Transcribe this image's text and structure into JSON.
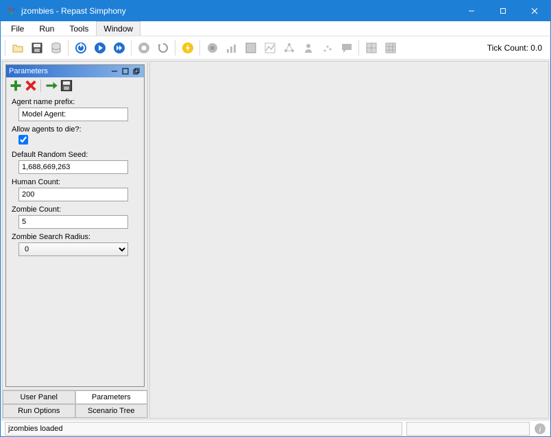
{
  "titlebar": {
    "title": "jzombies - Repast Simphony"
  },
  "menu": {
    "items": [
      "File",
      "Run",
      "Tools",
      "Window"
    ],
    "active_index": 3
  },
  "toolbar": {
    "tick_label": "Tick Count: 0.0"
  },
  "panel": {
    "title": "Parameters",
    "params": {
      "agent_prefix": {
        "label": "Agent name prefix:",
        "value": "Model Agent:"
      },
      "allow_die": {
        "label": "Allow agents to die?:",
        "value": true
      },
      "random_seed": {
        "label": "Default Random Seed:",
        "value": "1,688,669,263"
      },
      "human_count": {
        "label": "Human Count:",
        "value": "200"
      },
      "zombie_count": {
        "label": "Zombie Count:",
        "value": "5"
      },
      "search_radius": {
        "label": "Zombie Search Radius:",
        "value": "0"
      }
    }
  },
  "tabs": {
    "user_panel": "User Panel",
    "parameters": "Parameters",
    "run_options": "Run Options",
    "scenario_tree": "Scenario Tree",
    "active": "parameters"
  },
  "status": {
    "text": "jzombies loaded"
  }
}
